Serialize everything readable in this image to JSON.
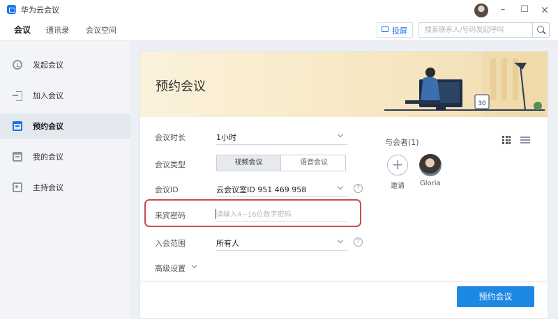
{
  "window": {
    "title": "华为云会议",
    "controls": {
      "minimize": "–",
      "maximize": "☐",
      "close": "×"
    }
  },
  "top_nav": {
    "tabs": [
      {
        "label": "会议",
        "active": true
      },
      {
        "label": "通讯录",
        "active": false
      },
      {
        "label": "会议空间",
        "active": false
      }
    ],
    "cast_label": "投屏",
    "search_placeholder": "搜索联系人/号码发起呼叫"
  },
  "sidebar": {
    "items": [
      {
        "label": "发起会议",
        "icon": "clock-icon",
        "active": false
      },
      {
        "label": "加入会议",
        "icon": "enter-icon",
        "active": false
      },
      {
        "label": "预约会议",
        "icon": "calendar-icon",
        "active": true
      },
      {
        "label": "我的会议",
        "icon": "calendar-icon",
        "active": false
      },
      {
        "label": "主持会议",
        "icon": "host-icon",
        "active": false
      }
    ]
  },
  "panel": {
    "title": "预约会议",
    "illustration": {
      "calendar_day": "30"
    },
    "form": {
      "duration": {
        "label": "会议时长",
        "value": "1小时"
      },
      "meeting_type": {
        "label": "会议类型",
        "options": [
          "视频会议",
          "语音会议"
        ],
        "selected": "视频会议"
      },
      "meeting_id": {
        "label": "会议ID",
        "value": "云会议室ID 951 469 958"
      },
      "guest_password": {
        "label": "来宾密码",
        "placeholder": "请输入4~16位数字密码",
        "value": ""
      },
      "join_scope": {
        "label": "入会范围",
        "value": "所有人"
      },
      "advanced_label": "高级设置",
      "help_glyph": "?"
    },
    "participants": {
      "title": "与会者(1)",
      "invite_glyph": "+",
      "invite_label": "邀请",
      "members": [
        {
          "name": "Gloria"
        }
      ]
    },
    "submit_label": "预约会议"
  },
  "colors": {
    "accent": "#1e88e5",
    "highlight_border": "#c84b4b",
    "banner": "#f7e8c4",
    "sidebar_bg": "#f2f4f7"
  }
}
